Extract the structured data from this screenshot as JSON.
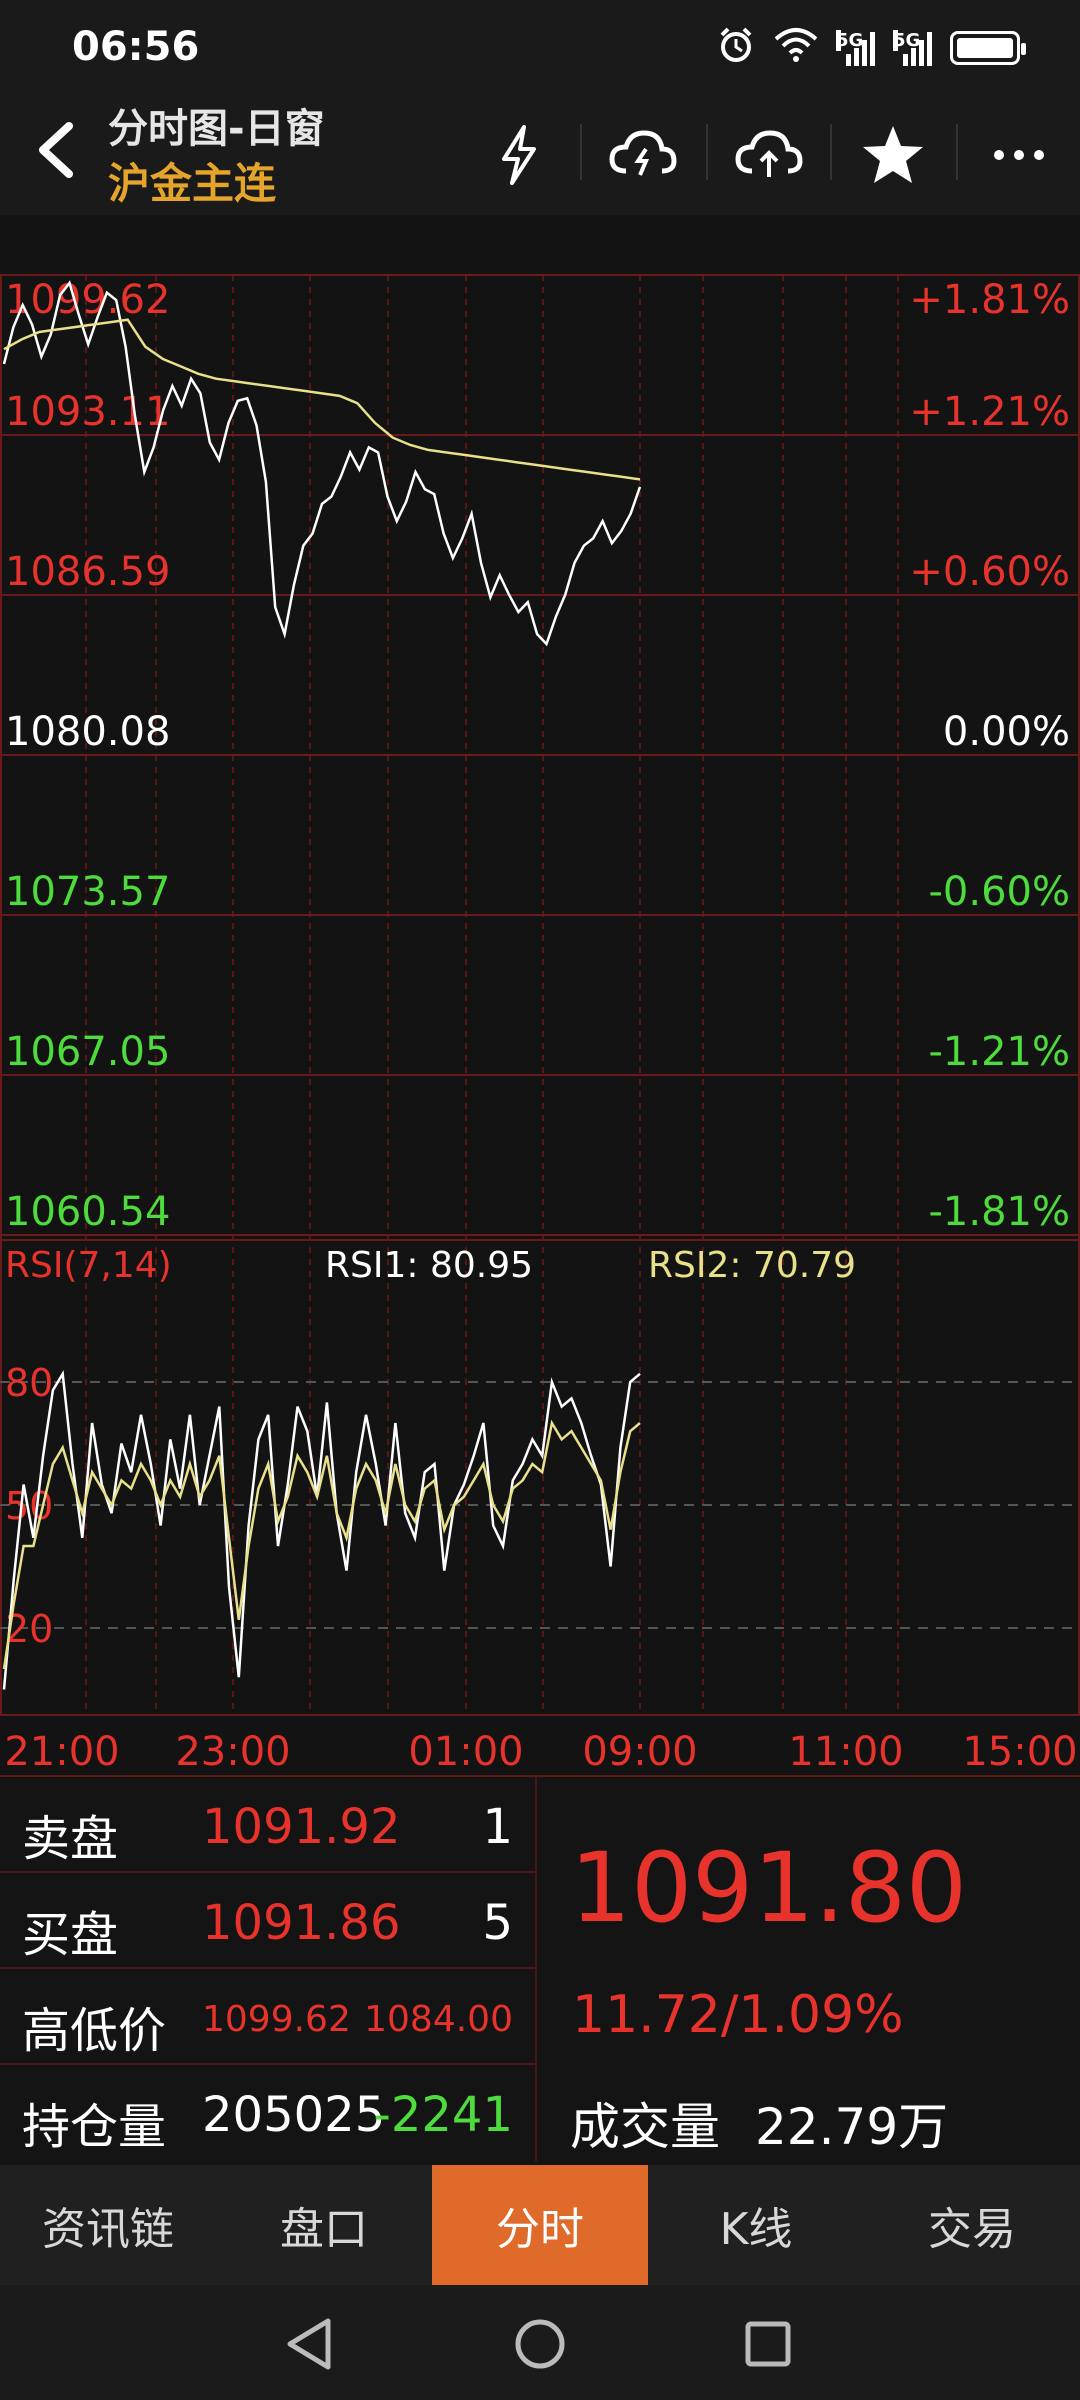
{
  "status_bar": {
    "time": "06:56",
    "icons": [
      "alarm-icon",
      "wifi-icon",
      "signal-5g-icon",
      "signal-5g-icon",
      "battery-icon"
    ],
    "network_label_1": "5G",
    "network_label_2": "5G"
  },
  "header": {
    "title": "分时图-日窗",
    "subtitle": "沪金主连",
    "actions": [
      "flash-icon",
      "cloud-download-icon",
      "cloud-upload-icon",
      "star-icon",
      "more-icon"
    ]
  },
  "chart_data": [
    {
      "type": "line",
      "name": "price-intraday",
      "y_labels_left": [
        "1099.62",
        "1093.11",
        "1086.59",
        "1080.08",
        "1073.57",
        "1067.05",
        "1060.54"
      ],
      "y_labels_right": [
        "+1.81%",
        "+1.21%",
        "+0.60%",
        "0.00%",
        "-0.60%",
        "-1.21%",
        "-1.81%"
      ],
      "ylim": [
        1060.54,
        1099.62
      ],
      "x_tick_labels": [
        "21:00",
        "23:00",
        "01:00",
        "09:00",
        "11:00",
        "15:00"
      ],
      "series": [
        {
          "color": "#ffffff",
          "values": [
            1096.0,
            1097.5,
            1098.4,
            1097.6,
            1096.3,
            1097.2,
            1098.8,
            1099.3,
            1098.0,
            1096.8,
            1097.9,
            1098.9,
            1098.6,
            1096.7,
            1093.9,
            1091.6,
            1092.6,
            1094.1,
            1095.1,
            1094.3,
            1095.4,
            1094.8,
            1092.8,
            1092.1,
            1093.6,
            1094.5,
            1094.6,
            1093.5,
            1091.2,
            1086.1,
            1085.0,
            1087.0,
            1088.6,
            1089.1,
            1090.3,
            1090.6,
            1091.4,
            1092.4,
            1091.7,
            1092.6,
            1092.4,
            1090.6,
            1089.6,
            1090.4,
            1091.6,
            1090.9,
            1090.7,
            1089.1,
            1088.1,
            1088.9,
            1089.9,
            1087.9,
            1086.5,
            1087.4,
            1086.6,
            1085.9,
            1086.3,
            1085.0,
            1084.6,
            1085.7,
            1086.6,
            1087.9,
            1088.6,
            1088.9,
            1089.6,
            1088.7,
            1089.2,
            1089.9,
            1091.0
          ]
        },
        {
          "color": "#e8e08a",
          "values": [
            1096.6,
            1097.0,
            1097.3,
            1097.4,
            1097.5,
            1097.6,
            1097.7,
            1097.8,
            1096.7,
            1096.2,
            1095.9,
            1095.6,
            1095.4,
            1095.3,
            1095.2,
            1095.1,
            1095.0,
            1094.9,
            1094.8,
            1094.7,
            1094.4,
            1093.6,
            1093.0,
            1092.7,
            1092.5,
            1092.4,
            1092.3,
            1092.2,
            1092.1,
            1092.0,
            1091.9,
            1091.8,
            1091.7,
            1091.6,
            1091.5,
            1091.4,
            1091.3
          ]
        }
      ]
    },
    {
      "type": "line",
      "name": "rsi",
      "title": "RSI(7,14)",
      "ylim": [
        0,
        100
      ],
      "y_tick_labels": [
        "80",
        "50",
        "20"
      ],
      "series": [
        {
          "name": "RSI1",
          "color": "#ffffff",
          "values": [
            5,
            32,
            55,
            42,
            62,
            78,
            82,
            60,
            42,
            70,
            55,
            48,
            65,
            58,
            72,
            60,
            45,
            66,
            54,
            72,
            50,
            62,
            74,
            30,
            8,
            45,
            66,
            72,
            40,
            55,
            74,
            68,
            52,
            75,
            48,
            34,
            58,
            72,
            60,
            45,
            70,
            48,
            42,
            58,
            60,
            34,
            50,
            55,
            62,
            70,
            45,
            40,
            56,
            60,
            66,
            62,
            80,
            74,
            76,
            70,
            62,
            55,
            35,
            64,
            80,
            82
          ]
        },
        {
          "name": "RSI2",
          "color": "#e8e08a",
          "values": [
            10,
            26,
            40,
            40,
            50,
            60,
            64,
            56,
            48,
            58,
            54,
            50,
            56,
            54,
            60,
            56,
            50,
            56,
            52,
            60,
            52,
            56,
            62,
            42,
            22,
            40,
            54,
            60,
            46,
            52,
            62,
            58,
            52,
            62,
            48,
            42,
            54,
            60,
            56,
            48,
            60,
            50,
            46,
            54,
            56,
            44,
            50,
            52,
            56,
            60,
            50,
            46,
            54,
            56,
            60,
            58,
            70,
            66,
            68,
            64,
            60,
            56,
            44,
            58,
            68,
            70
          ]
        }
      ]
    }
  ],
  "rsi_readout": {
    "title": "RSI(7,14)",
    "rsi1": "RSI1: 80.95",
    "rsi2": "RSI2: 70.79"
  },
  "quote": {
    "ask_label": "卖盘",
    "ask_price": "1091.92",
    "ask_qty": "1",
    "bid_label": "买盘",
    "bid_price": "1091.86",
    "bid_qty": "5",
    "hl_label": "高低价",
    "high": "1099.62",
    "low": "1084.00",
    "oi_label": "持仓量",
    "oi_value": "205025",
    "oi_change": "-2241",
    "last_price": "1091.80",
    "change": "11.72/1.09%",
    "volume_label": "成交量",
    "volume_value": "22.79万"
  },
  "tabs": [
    {
      "label": "资讯链",
      "active": false
    },
    {
      "label": "盘口",
      "active": false
    },
    {
      "label": "分时",
      "active": true
    },
    {
      "label": "K线",
      "active": false
    },
    {
      "label": "交易",
      "active": false
    }
  ],
  "colors": {
    "up": "#e8332d",
    "down": "#4ddc3b",
    "accent": "#e06a2a",
    "subtitle": "#e5a52b",
    "avg_line": "#e8e08a"
  }
}
